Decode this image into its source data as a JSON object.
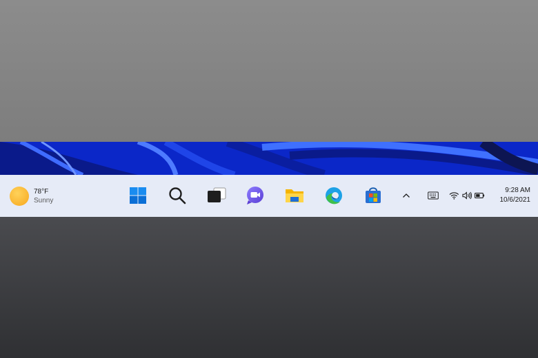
{
  "weather": {
    "temperature": "78°F",
    "condition": "Sunny",
    "icon": "sun-icon"
  },
  "taskbar_apps": [
    {
      "name": "start",
      "icon": "windows-logo-icon"
    },
    {
      "name": "search",
      "icon": "search-icon"
    },
    {
      "name": "task-view",
      "icon": "task-view-icon"
    },
    {
      "name": "teams-chat",
      "icon": "chat-icon"
    },
    {
      "name": "file-explorer",
      "icon": "folder-icon"
    },
    {
      "name": "edge",
      "icon": "edge-icon"
    },
    {
      "name": "store",
      "icon": "store-icon"
    }
  ],
  "tray": {
    "chevron": "^",
    "icons": [
      "keyboard-icon",
      "wifi-icon",
      "volume-icon",
      "battery-icon"
    ]
  },
  "clock": {
    "time": "9:28 AM",
    "date": "10/6/2021"
  },
  "colors": {
    "taskbar": "#e6ebf7",
    "wallpaper_blue": "#0a1fb0",
    "accent": "#0078d4"
  }
}
